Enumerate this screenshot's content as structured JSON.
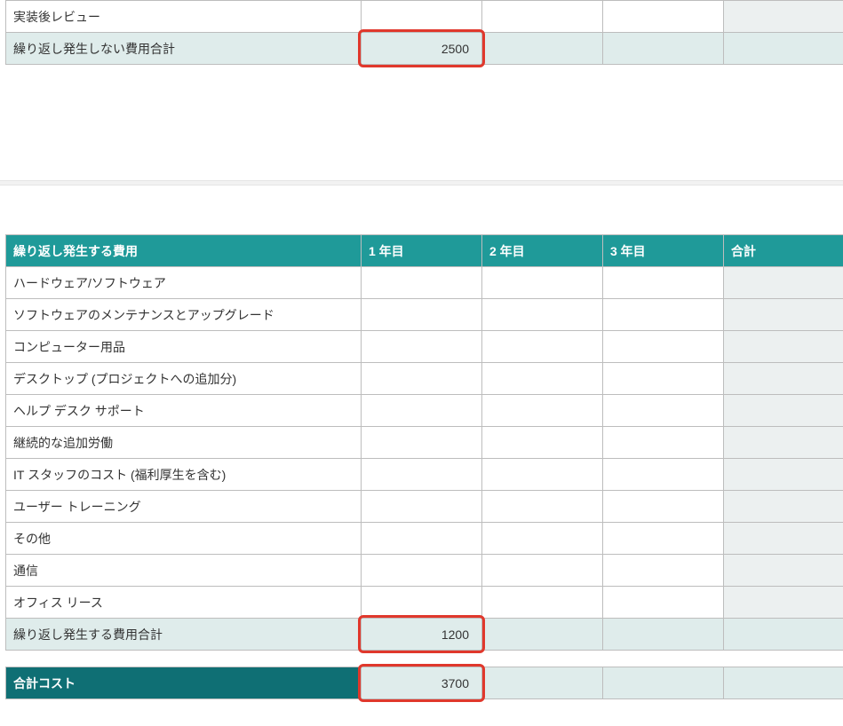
{
  "top": {
    "row_label": "実装後レビュー",
    "subtotal_label": "繰り返し発生しない費用合計",
    "subtotal_value": "2500"
  },
  "recurring": {
    "header": {
      "title": "繰り返し発生する費用",
      "y1": "1 年目",
      "y2": "2 年目",
      "y3": "3 年目",
      "total": "合計"
    },
    "rows": [
      "ハードウェア/ソフトウェア",
      "ソフトウェアのメンテナンスとアップグレード",
      "コンピューター用品",
      "デスクトップ (プロジェクトへの追加分)",
      "ヘルプ デスク サポート",
      "継続的な追加労働",
      "IT スタッフのコスト (福利厚生を含む)",
      "ユーザー トレーニング",
      "その他",
      "通信",
      "オフィス リース"
    ],
    "subtotal_label": "繰り返し発生する費用合計",
    "subtotal_value": "1200"
  },
  "grand": {
    "label": "合計コスト",
    "value": "3700"
  }
}
